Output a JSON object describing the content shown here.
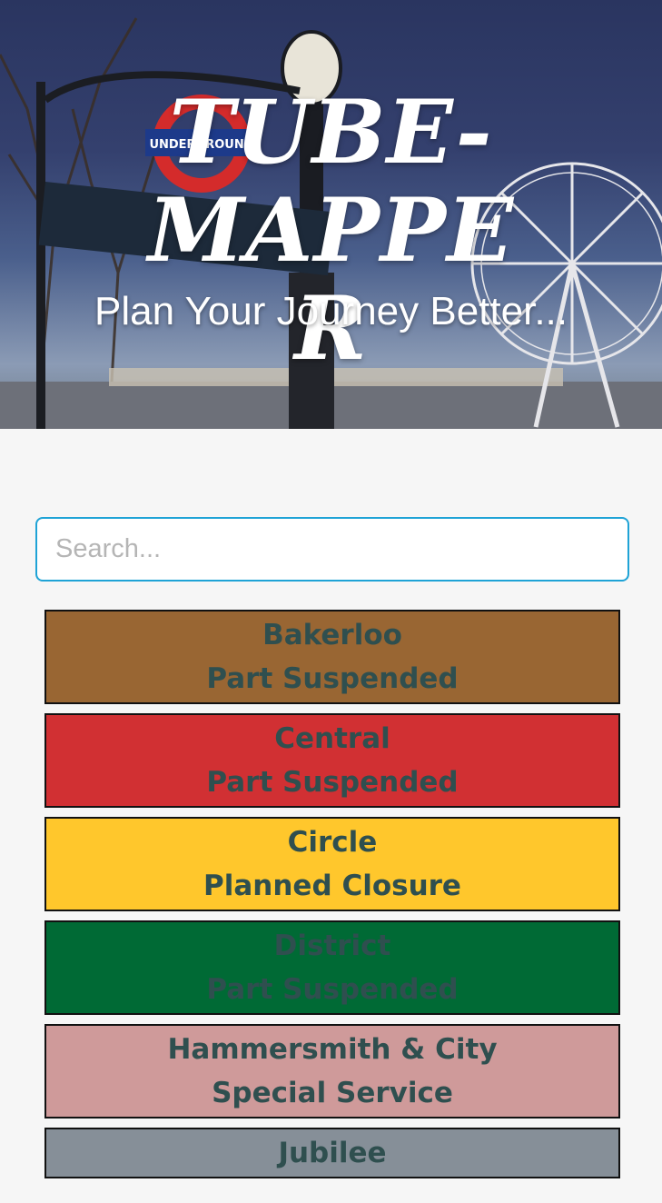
{
  "hero": {
    "title": "TUBE-MAPPER",
    "subtitle": "Plan Your Journey Better...",
    "sign_text": "UNDERGROUND"
  },
  "search": {
    "placeholder": "Search...",
    "value": ""
  },
  "lines": [
    {
      "name": "Bakerloo",
      "status": "Part Suspended",
      "color": "#996633"
    },
    {
      "name": "Central",
      "status": "Part Suspended",
      "color": "#d13033"
    },
    {
      "name": "Circle",
      "status": "Planned Closure",
      "color": "#ffc72c"
    },
    {
      "name": "District",
      "status": "Part Suspended",
      "color": "#006a35"
    },
    {
      "name": "Hammersmith & City",
      "status": "Special Service",
      "color": "#cf9a9a"
    },
    {
      "name": "Jubilee",
      "status": "",
      "color": "#868f98"
    }
  ]
}
